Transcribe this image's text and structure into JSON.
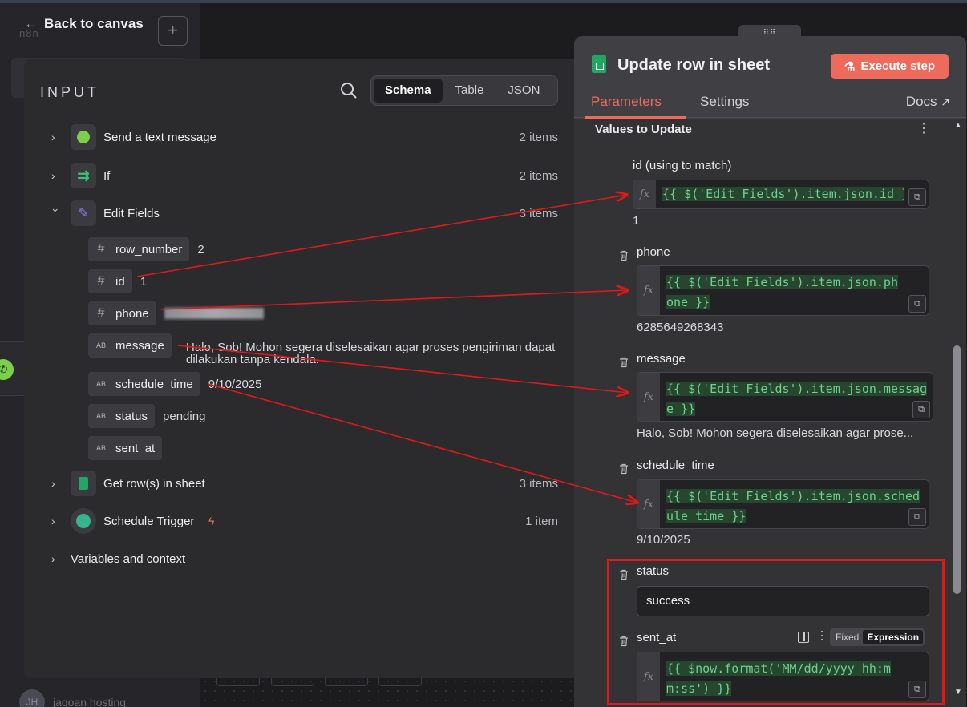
{
  "canvas": {
    "back_label": "Back to canvas",
    "logo_text": "n8n",
    "bottom_user_initials": "JH",
    "bottom_user_name": "jagoan hosting"
  },
  "input": {
    "title": "INPUT",
    "view_tabs": [
      "Schema",
      "Table",
      "JSON"
    ],
    "active_view": "Schema",
    "nodes": [
      {
        "label": "Send a text message",
        "count": "2 items",
        "icon": "whatsapp-icon",
        "expanded": false
      },
      {
        "label": "If",
        "count": "2 items",
        "icon": "if-branch-icon",
        "expanded": false
      },
      {
        "label": "Edit Fields",
        "count": "3 items",
        "icon": "pencil-icon",
        "expanded": true
      },
      {
        "label": "Get row(s) in sheet",
        "count": "3 items",
        "icon": "google-sheets-icon",
        "expanded": false
      },
      {
        "label": "Schedule Trigger",
        "count": "1 item",
        "icon": "clock-icon",
        "expanded": false
      },
      {
        "label": "Variables and context",
        "count": "",
        "expanded": false
      }
    ],
    "fields": [
      {
        "type": "#",
        "name": "row_number",
        "value": "2"
      },
      {
        "type": "#",
        "name": "id",
        "value": "1"
      },
      {
        "type": "#",
        "name": "phone",
        "value": ""
      },
      {
        "type": "AB",
        "name": "message",
        "value": "Halo, Sob! Mohon segera diselesaikan agar proses pengiriman dapat dilakukan tanpa kendala."
      },
      {
        "type": "AB",
        "name": "schedule_time",
        "value": "9/10/2025"
      },
      {
        "type": "AB",
        "name": "status",
        "value": "pending"
      },
      {
        "type": "AB",
        "name": "sent_at",
        "value": ""
      }
    ]
  },
  "node": {
    "title": "Update row in sheet",
    "execute_label": "Execute step",
    "tabs": [
      "Parameters",
      "Settings"
    ],
    "active_tab": "Parameters",
    "docs_label": "Docs",
    "section_title": "Values to Update",
    "params": [
      {
        "label": "id (using to match)",
        "expr": "{{ $('Edit Fields').item.json.id }}",
        "result": "1"
      },
      {
        "label": "phone",
        "expr": "{{ $('Edit Fields').item.json.phone }}",
        "result": "6285649268343"
      },
      {
        "label": "message",
        "expr": "{{ $('Edit Fields').item.json.message }}",
        "result": "Halo, Sob! Mohon segera diselesaikan agar prose..."
      },
      {
        "label": "schedule_time",
        "expr": "{{ $('Edit Fields').item.json.schedule_time }}",
        "result": "9/10/2025"
      },
      {
        "label": "status",
        "value": "success"
      },
      {
        "label": "sent_at",
        "expr": "{{ $now.format('MM/dd/yyyy hh:mm:ss') }}",
        "mode_options": [
          "Fixed",
          "Expression"
        ],
        "active_mode": "Expression"
      }
    ]
  },
  "colors": {
    "accent": "#ee6b5b",
    "annotation": "#e21818",
    "expression_text": "#6fd18c"
  }
}
